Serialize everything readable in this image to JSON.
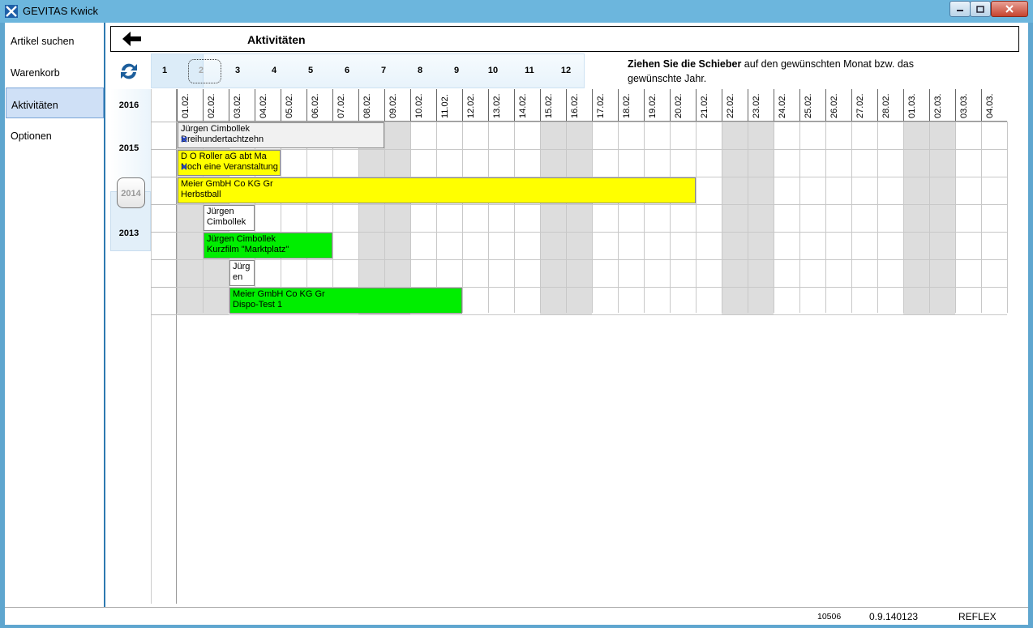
{
  "window": {
    "title": "GEVITAS Kwick"
  },
  "sidebar": {
    "items": [
      {
        "label": "Artikel suchen"
      },
      {
        "label": "Warenkorb"
      },
      {
        "label": "Aktivitäten"
      },
      {
        "label": "Optionen"
      }
    ]
  },
  "header": {
    "title": "Aktivitäten"
  },
  "months": [
    "1",
    "2",
    "3",
    "4",
    "5",
    "6",
    "7",
    "8",
    "9",
    "10",
    "11",
    "12"
  ],
  "selected_month": "2",
  "hint": {
    "bold": "Ziehen Sie die Schieber",
    "rest": " auf den gewünschten Monat bzw. das gewünschte Jahr."
  },
  "years": [
    "2016",
    "2015",
    "2014",
    "2013"
  ],
  "selected_year": "2014",
  "days": [
    "01.02.",
    "02.02.",
    "03.02.",
    "04.02.",
    "05.02.",
    "06.02.",
    "07.02.",
    "08.02.",
    "09.02.",
    "10.02.",
    "11.02.",
    "12.02.",
    "13.02.",
    "14.02.",
    "15.02.",
    "16.02.",
    "17.02.",
    "18.02.",
    "19.02.",
    "20.02.",
    "21.02.",
    "22.02.",
    "23.02.",
    "24.02.",
    "25.02.",
    "26.02.",
    "27.02.",
    "28.02.",
    "01.03.",
    "02.03.",
    "03.03.",
    "04.03."
  ],
  "weekend_days": [
    "01.02.",
    "02.02.",
    "08.02.",
    "09.02.",
    "15.02.",
    "16.02.",
    "22.02.",
    "23.02.",
    "01.03.",
    "02.03."
  ],
  "activities": [
    {
      "line1": "Jürgen Cimbollek",
      "line2": "Dreihundertachtzehn",
      "color": "gray",
      "start": "01.02.",
      "end": "08.02.",
      "row": 1,
      "icon": true
    },
    {
      "line1": "D O Roller aG abt Ma",
      "line2": "Noch eine Veranstaltung",
      "color": "yellow",
      "start": "01.02.",
      "end": "04.02.",
      "row": 2,
      "icon": true
    },
    {
      "line1": "Meier GmbH  Co KG Gr",
      "line2": " Herbstball",
      "color": "yellow",
      "start": "01.02.",
      "end": "20.02.",
      "row": 3,
      "icon": false
    },
    {
      "line1": "Jürgen",
      "line2": "Cimbollek",
      "color": "white",
      "start": "02.02.",
      "end": "03.02.",
      "row": 4,
      "icon": false
    },
    {
      "line1": "Jürgen Cimbollek",
      "line2": " Kurzfilm \"Marktplatz\"",
      "color": "green",
      "start": "02.02.",
      "end": "06.02.",
      "row": 5,
      "icon": false
    },
    {
      "line1": "Jürg",
      "line2": "en",
      "color": "white",
      "start": "03.02.",
      "end": "03.02.",
      "row": 6,
      "icon": false
    },
    {
      "line1": "Meier GmbH  Co KG Gr",
      "line2": " Dispo-Test 1",
      "color": "green",
      "start": "03.02.",
      "end": "11.02.",
      "row": 7,
      "icon": false
    }
  ],
  "status": {
    "code": "10506",
    "version": "0.9.140123",
    "db": "REFLEX"
  },
  "colors": {
    "titlebar": "#6cb6dd",
    "frame": "#2e7ab0",
    "active_item": "#cfe0f6",
    "yellow": "#ffff00",
    "green": "#00ee00",
    "weekend": "#dddddd"
  }
}
